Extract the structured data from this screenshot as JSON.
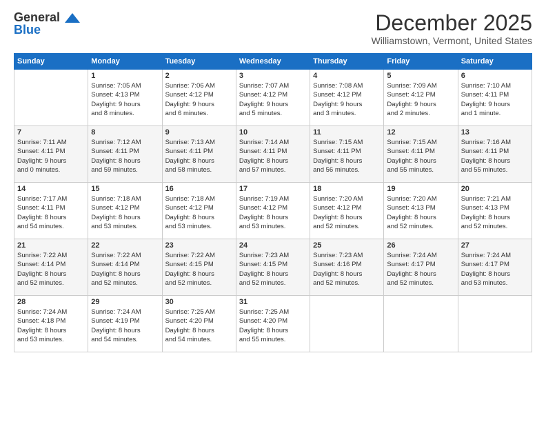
{
  "logo": {
    "line1": "General",
    "line2": "Blue"
  },
  "title": "December 2025",
  "location": "Williamstown, Vermont, United States",
  "days_header": [
    "Sunday",
    "Monday",
    "Tuesday",
    "Wednesday",
    "Thursday",
    "Friday",
    "Saturday"
  ],
  "weeks": [
    [
      {
        "num": "",
        "info": ""
      },
      {
        "num": "1",
        "info": "Sunrise: 7:05 AM\nSunset: 4:13 PM\nDaylight: 9 hours\nand 8 minutes."
      },
      {
        "num": "2",
        "info": "Sunrise: 7:06 AM\nSunset: 4:12 PM\nDaylight: 9 hours\nand 6 minutes."
      },
      {
        "num": "3",
        "info": "Sunrise: 7:07 AM\nSunset: 4:12 PM\nDaylight: 9 hours\nand 5 minutes."
      },
      {
        "num": "4",
        "info": "Sunrise: 7:08 AM\nSunset: 4:12 PM\nDaylight: 9 hours\nand 3 minutes."
      },
      {
        "num": "5",
        "info": "Sunrise: 7:09 AM\nSunset: 4:12 PM\nDaylight: 9 hours\nand 2 minutes."
      },
      {
        "num": "6",
        "info": "Sunrise: 7:10 AM\nSunset: 4:11 PM\nDaylight: 9 hours\nand 1 minute."
      }
    ],
    [
      {
        "num": "7",
        "info": "Sunrise: 7:11 AM\nSunset: 4:11 PM\nDaylight: 9 hours\nand 0 minutes."
      },
      {
        "num": "8",
        "info": "Sunrise: 7:12 AM\nSunset: 4:11 PM\nDaylight: 8 hours\nand 59 minutes."
      },
      {
        "num": "9",
        "info": "Sunrise: 7:13 AM\nSunset: 4:11 PM\nDaylight: 8 hours\nand 58 minutes."
      },
      {
        "num": "10",
        "info": "Sunrise: 7:14 AM\nSunset: 4:11 PM\nDaylight: 8 hours\nand 57 minutes."
      },
      {
        "num": "11",
        "info": "Sunrise: 7:15 AM\nSunset: 4:11 PM\nDaylight: 8 hours\nand 56 minutes."
      },
      {
        "num": "12",
        "info": "Sunrise: 7:15 AM\nSunset: 4:11 PM\nDaylight: 8 hours\nand 55 minutes."
      },
      {
        "num": "13",
        "info": "Sunrise: 7:16 AM\nSunset: 4:11 PM\nDaylight: 8 hours\nand 55 minutes."
      }
    ],
    [
      {
        "num": "14",
        "info": "Sunrise: 7:17 AM\nSunset: 4:11 PM\nDaylight: 8 hours\nand 54 minutes."
      },
      {
        "num": "15",
        "info": "Sunrise: 7:18 AM\nSunset: 4:12 PM\nDaylight: 8 hours\nand 53 minutes."
      },
      {
        "num": "16",
        "info": "Sunrise: 7:18 AM\nSunset: 4:12 PM\nDaylight: 8 hours\nand 53 minutes."
      },
      {
        "num": "17",
        "info": "Sunrise: 7:19 AM\nSunset: 4:12 PM\nDaylight: 8 hours\nand 53 minutes."
      },
      {
        "num": "18",
        "info": "Sunrise: 7:20 AM\nSunset: 4:12 PM\nDaylight: 8 hours\nand 52 minutes."
      },
      {
        "num": "19",
        "info": "Sunrise: 7:20 AM\nSunset: 4:13 PM\nDaylight: 8 hours\nand 52 minutes."
      },
      {
        "num": "20",
        "info": "Sunrise: 7:21 AM\nSunset: 4:13 PM\nDaylight: 8 hours\nand 52 minutes."
      }
    ],
    [
      {
        "num": "21",
        "info": "Sunrise: 7:22 AM\nSunset: 4:14 PM\nDaylight: 8 hours\nand 52 minutes."
      },
      {
        "num": "22",
        "info": "Sunrise: 7:22 AM\nSunset: 4:14 PM\nDaylight: 8 hours\nand 52 minutes."
      },
      {
        "num": "23",
        "info": "Sunrise: 7:22 AM\nSunset: 4:15 PM\nDaylight: 8 hours\nand 52 minutes."
      },
      {
        "num": "24",
        "info": "Sunrise: 7:23 AM\nSunset: 4:15 PM\nDaylight: 8 hours\nand 52 minutes."
      },
      {
        "num": "25",
        "info": "Sunrise: 7:23 AM\nSunset: 4:16 PM\nDaylight: 8 hours\nand 52 minutes."
      },
      {
        "num": "26",
        "info": "Sunrise: 7:24 AM\nSunset: 4:17 PM\nDaylight: 8 hours\nand 52 minutes."
      },
      {
        "num": "27",
        "info": "Sunrise: 7:24 AM\nSunset: 4:17 PM\nDaylight: 8 hours\nand 53 minutes."
      }
    ],
    [
      {
        "num": "28",
        "info": "Sunrise: 7:24 AM\nSunset: 4:18 PM\nDaylight: 8 hours\nand 53 minutes."
      },
      {
        "num": "29",
        "info": "Sunrise: 7:24 AM\nSunset: 4:19 PM\nDaylight: 8 hours\nand 54 minutes."
      },
      {
        "num": "30",
        "info": "Sunrise: 7:25 AM\nSunset: 4:20 PM\nDaylight: 8 hours\nand 54 minutes."
      },
      {
        "num": "31",
        "info": "Sunrise: 7:25 AM\nSunset: 4:20 PM\nDaylight: 8 hours\nand 55 minutes."
      },
      {
        "num": "",
        "info": ""
      },
      {
        "num": "",
        "info": ""
      },
      {
        "num": "",
        "info": ""
      }
    ]
  ]
}
